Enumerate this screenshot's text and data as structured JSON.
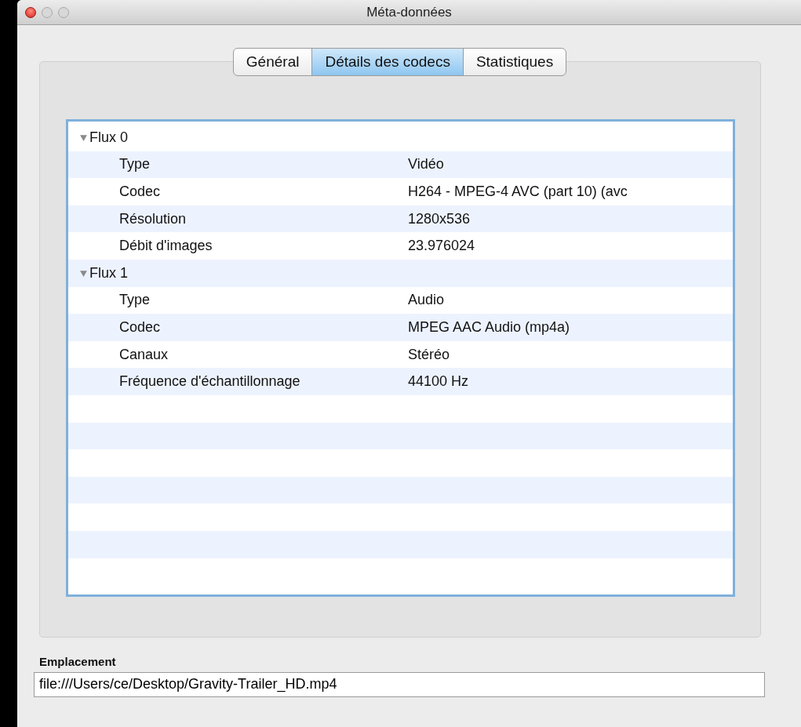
{
  "window": {
    "title": "Méta-données"
  },
  "tabs": [
    {
      "label": "Général",
      "selected": false
    },
    {
      "label": "Détails des codecs",
      "selected": true
    },
    {
      "label": "Statistiques",
      "selected": false
    }
  ],
  "tree": [
    {
      "label": "Flux 0",
      "expanded": true,
      "children": [
        {
          "key": "Type",
          "value": "Vidéo"
        },
        {
          "key": "Codec",
          "value": "H264 - MPEG-4 AVC (part 10) (avc"
        },
        {
          "key": "Résolution",
          "value": "1280x536"
        },
        {
          "key": "Débit d'images",
          "value": "23.976024"
        }
      ]
    },
    {
      "label": "Flux 1",
      "expanded": true,
      "children": [
        {
          "key": "Type",
          "value": "Audio"
        },
        {
          "key": "Codec",
          "value": "MPEG AAC Audio (mp4a)"
        },
        {
          "key": "Canaux",
          "value": "Stéréo"
        },
        {
          "key": "Fréquence d'échantillonnage",
          "value": "44100 Hz"
        }
      ]
    }
  ],
  "location": {
    "label": "Emplacement",
    "value": "file:///Users/ce/Desktop/Gravity-Trailer_HD.mp4"
  }
}
